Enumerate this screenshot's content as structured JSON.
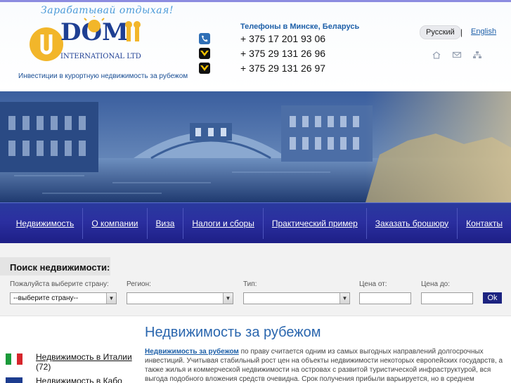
{
  "header": {
    "tagline": "Зарабатывай отдыхая!",
    "logo_text": "DOM",
    "logo_sub": "INTERNATIONAL LTD",
    "subtitle": "Инвестиции в курортную недвижимость за рубежом"
  },
  "phones": {
    "title": "Телефоны в Минске, Беларусь",
    "items": [
      {
        "icon": "landline-phone-icon",
        "number": "+ 375 17 201 93 06"
      },
      {
        "icon": "velcom-icon",
        "number": "+ 375 29 131 26 96"
      },
      {
        "icon": "velcom-icon",
        "number": "+ 375 29 131 26 97"
      }
    ]
  },
  "lang": {
    "ru": "Русский",
    "separator": "|",
    "en": "English"
  },
  "util_icons": [
    "home-icon",
    "mail-icon",
    "sitemap-icon"
  ],
  "nav": {
    "items": [
      "Недвижимость",
      "О компании",
      "Виза",
      "Налоги и сборы",
      "Практический пример",
      "Заказать брошюру",
      "Контакты"
    ]
  },
  "search": {
    "title": "Поиск недвижимости:",
    "country_label": "Пожалуйста выберите страну:",
    "country_value": "--выберите страну--",
    "region_label": "Регион:",
    "type_label": "Тип:",
    "price_from_label": "Цена от:",
    "price_to_label": "Цена до:",
    "ok": "Ok"
  },
  "countries": [
    {
      "title": "Недвижимость в Италии",
      "count": "(72)"
    },
    {
      "title": "Недвижимость в Кабо",
      "count": ""
    }
  ],
  "main": {
    "title": "Недвижимость за рубежом",
    "lead": "Недвижимость за рубежом",
    "text": " по праву считается одним из самых выгодных направлений долгосрочных инвестиций. Учитывая стабильный рост цен на объекты недвижимости некоторых европейских государств, а также жилья и коммерческой недвижимости на островах с развитой туристической инфраструктурой, вся выгода подобного вложения средств очевидна. Срок получения прибыли варьируется, но в среднем вложения"
  },
  "colors": {
    "accent_blue": "#1d5fa8",
    "nav_bg": "#2b2fa0",
    "logo_orange": "#f2b62a",
    "logo_blue": "#1e3f93"
  }
}
